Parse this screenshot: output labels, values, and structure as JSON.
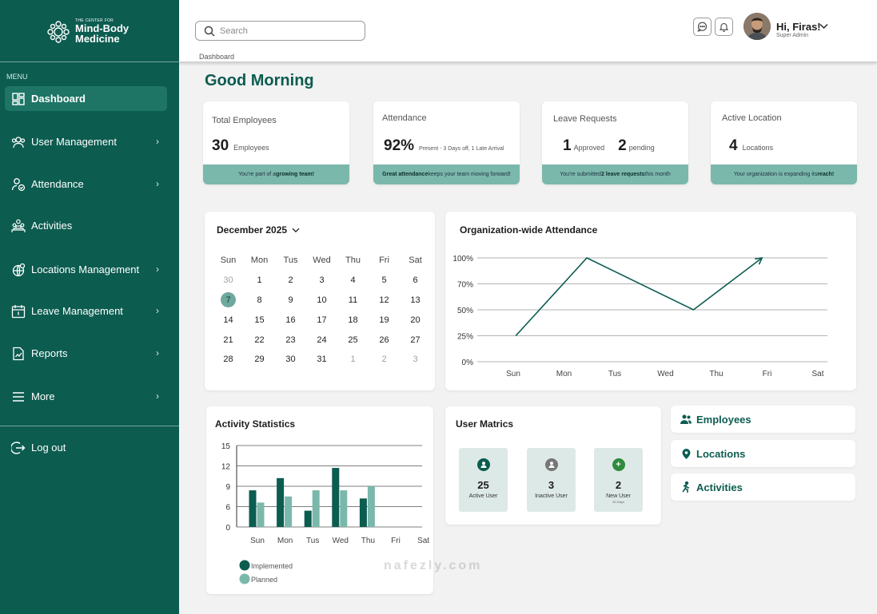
{
  "logo": {
    "small": "THE CENTER FOR",
    "line1": "Mind-Body",
    "line2": "Medicine"
  },
  "sidebar": {
    "menu_label": "MENU",
    "items": [
      {
        "label": "Dashboard",
        "icon": "grid-icon"
      },
      {
        "label": "User Management",
        "icon": "users-icon"
      },
      {
        "label": "Attendance",
        "icon": "user-check-icon"
      },
      {
        "label": "Activities",
        "icon": "group-icon"
      },
      {
        "label": "Locations Management",
        "icon": "globe-pin-icon"
      },
      {
        "label": "Leave Management",
        "icon": "calendar-icon"
      },
      {
        "label": "Reports",
        "icon": "report-icon"
      },
      {
        "label": "More",
        "icon": "menu-icon"
      }
    ],
    "logout_label": "Log out"
  },
  "header": {
    "search_placeholder": "Search",
    "breadcrumb": "Dashboard",
    "user_greeting": "Hi, Firas!",
    "user_role": "Super Admin"
  },
  "greeting": "Good Morning",
  "stats": [
    {
      "title": "Total Employees",
      "value": "30",
      "unit": "Employees",
      "foot_pre": "You're part of a ",
      "foot_bold": "growing team!",
      "foot_post": ""
    },
    {
      "title": "Attendance",
      "value": "92%",
      "unit": "Present - 3 Days off, 1 Late Arrival",
      "foot_pre": "",
      "foot_bold": "Great attendance",
      "foot_post": " keeps your team moving forward!"
    },
    {
      "title": "Leave Requests",
      "value": "1",
      "unit": "Approved",
      "value2": "2",
      "unit2": "pending",
      "foot_pre": "You're submitted ",
      "foot_bold": "2 leave requests",
      "foot_post": " this month"
    },
    {
      "title": "Active Location",
      "value": "4",
      "unit": "Locations",
      "foot_pre": "Your organization is expanding its ",
      "foot_bold": "reach!",
      "foot_post": ""
    }
  ],
  "calendar": {
    "month": "December 2025",
    "weekdays": [
      "Sun",
      "Mon",
      "Tus",
      "Wed",
      "Thu",
      "Fri",
      "Sat"
    ],
    "days": [
      "30",
      "1",
      "2",
      "3",
      "4",
      "5",
      "6",
      "7",
      "8",
      "9",
      "10",
      "11",
      "12",
      "13",
      "14",
      "15",
      "16",
      "17",
      "18",
      "19",
      "20",
      "21",
      "22",
      "23",
      "24",
      "25",
      "26",
      "27",
      "28",
      "29",
      "30",
      "31",
      "1",
      "2",
      "3"
    ],
    "muted": [
      0,
      32,
      33,
      34
    ],
    "selected": 7
  },
  "attendance_chart": {
    "title": "Organization-wide Attendance",
    "chart_data": {
      "type": "line",
      "categories": [
        "Sun",
        "Mon",
        "Tus",
        "Wed",
        "Thu",
        "Fri",
        "Sat"
      ],
      "x": [
        0.05,
        1.45,
        3.55,
        4.9
      ],
      "values": [
        25,
        100,
        50,
        100
      ],
      "y_ticks": [
        "0%",
        "25%",
        "50%",
        "70%",
        "100%"
      ],
      "y_tick_values": [
        0,
        25,
        50,
        75,
        100
      ],
      "ylim": [
        0,
        100
      ],
      "color": "#0c5c50",
      "grid": true
    }
  },
  "activity_chart": {
    "title": "Activity Statistics",
    "chart_data": {
      "type": "bar",
      "categories": [
        "Sun",
        "Mon",
        "Tus",
        "Wed",
        "Thu",
        "Fri",
        "Sat"
      ],
      "series": [
        {
          "name": "Implemented",
          "values": [
            9,
            12,
            4,
            14.5,
            7,
            0,
            0
          ],
          "color": "#0c5c50"
        },
        {
          "name": "Planned",
          "values": [
            6,
            7.5,
            9,
            9,
            10,
            0,
            0
          ],
          "color": "#7bb8ac"
        }
      ],
      "y_ticks": [
        "0",
        "6",
        "9",
        "12",
        "15"
      ],
      "y_tick_values": [
        0,
        5,
        10,
        15,
        20
      ],
      "ylim": [
        0,
        20
      ],
      "grid": true,
      "legend": "bottom-left"
    }
  },
  "user_metrics": {
    "title": "User Matrics",
    "items": [
      {
        "value": "25",
        "label": "Active User",
        "sub": "",
        "icon_color": "#0c5c50",
        "icon": "user-icon"
      },
      {
        "value": "3",
        "label": "Inactive User",
        "sub": "",
        "icon_color": "#777777",
        "icon": "user-icon"
      },
      {
        "value": "2",
        "label": "New User",
        "sub": "30 Days",
        "icon_color": "#2e8b3c",
        "icon": "plus-icon"
      }
    ]
  },
  "quick_links": [
    {
      "label": "Employees",
      "icon": "employees-icon"
    },
    {
      "label": "Locations",
      "icon": "pin-icon"
    },
    {
      "label": "Activities",
      "icon": "running-icon"
    }
  ],
  "watermark": "nafezly.com"
}
